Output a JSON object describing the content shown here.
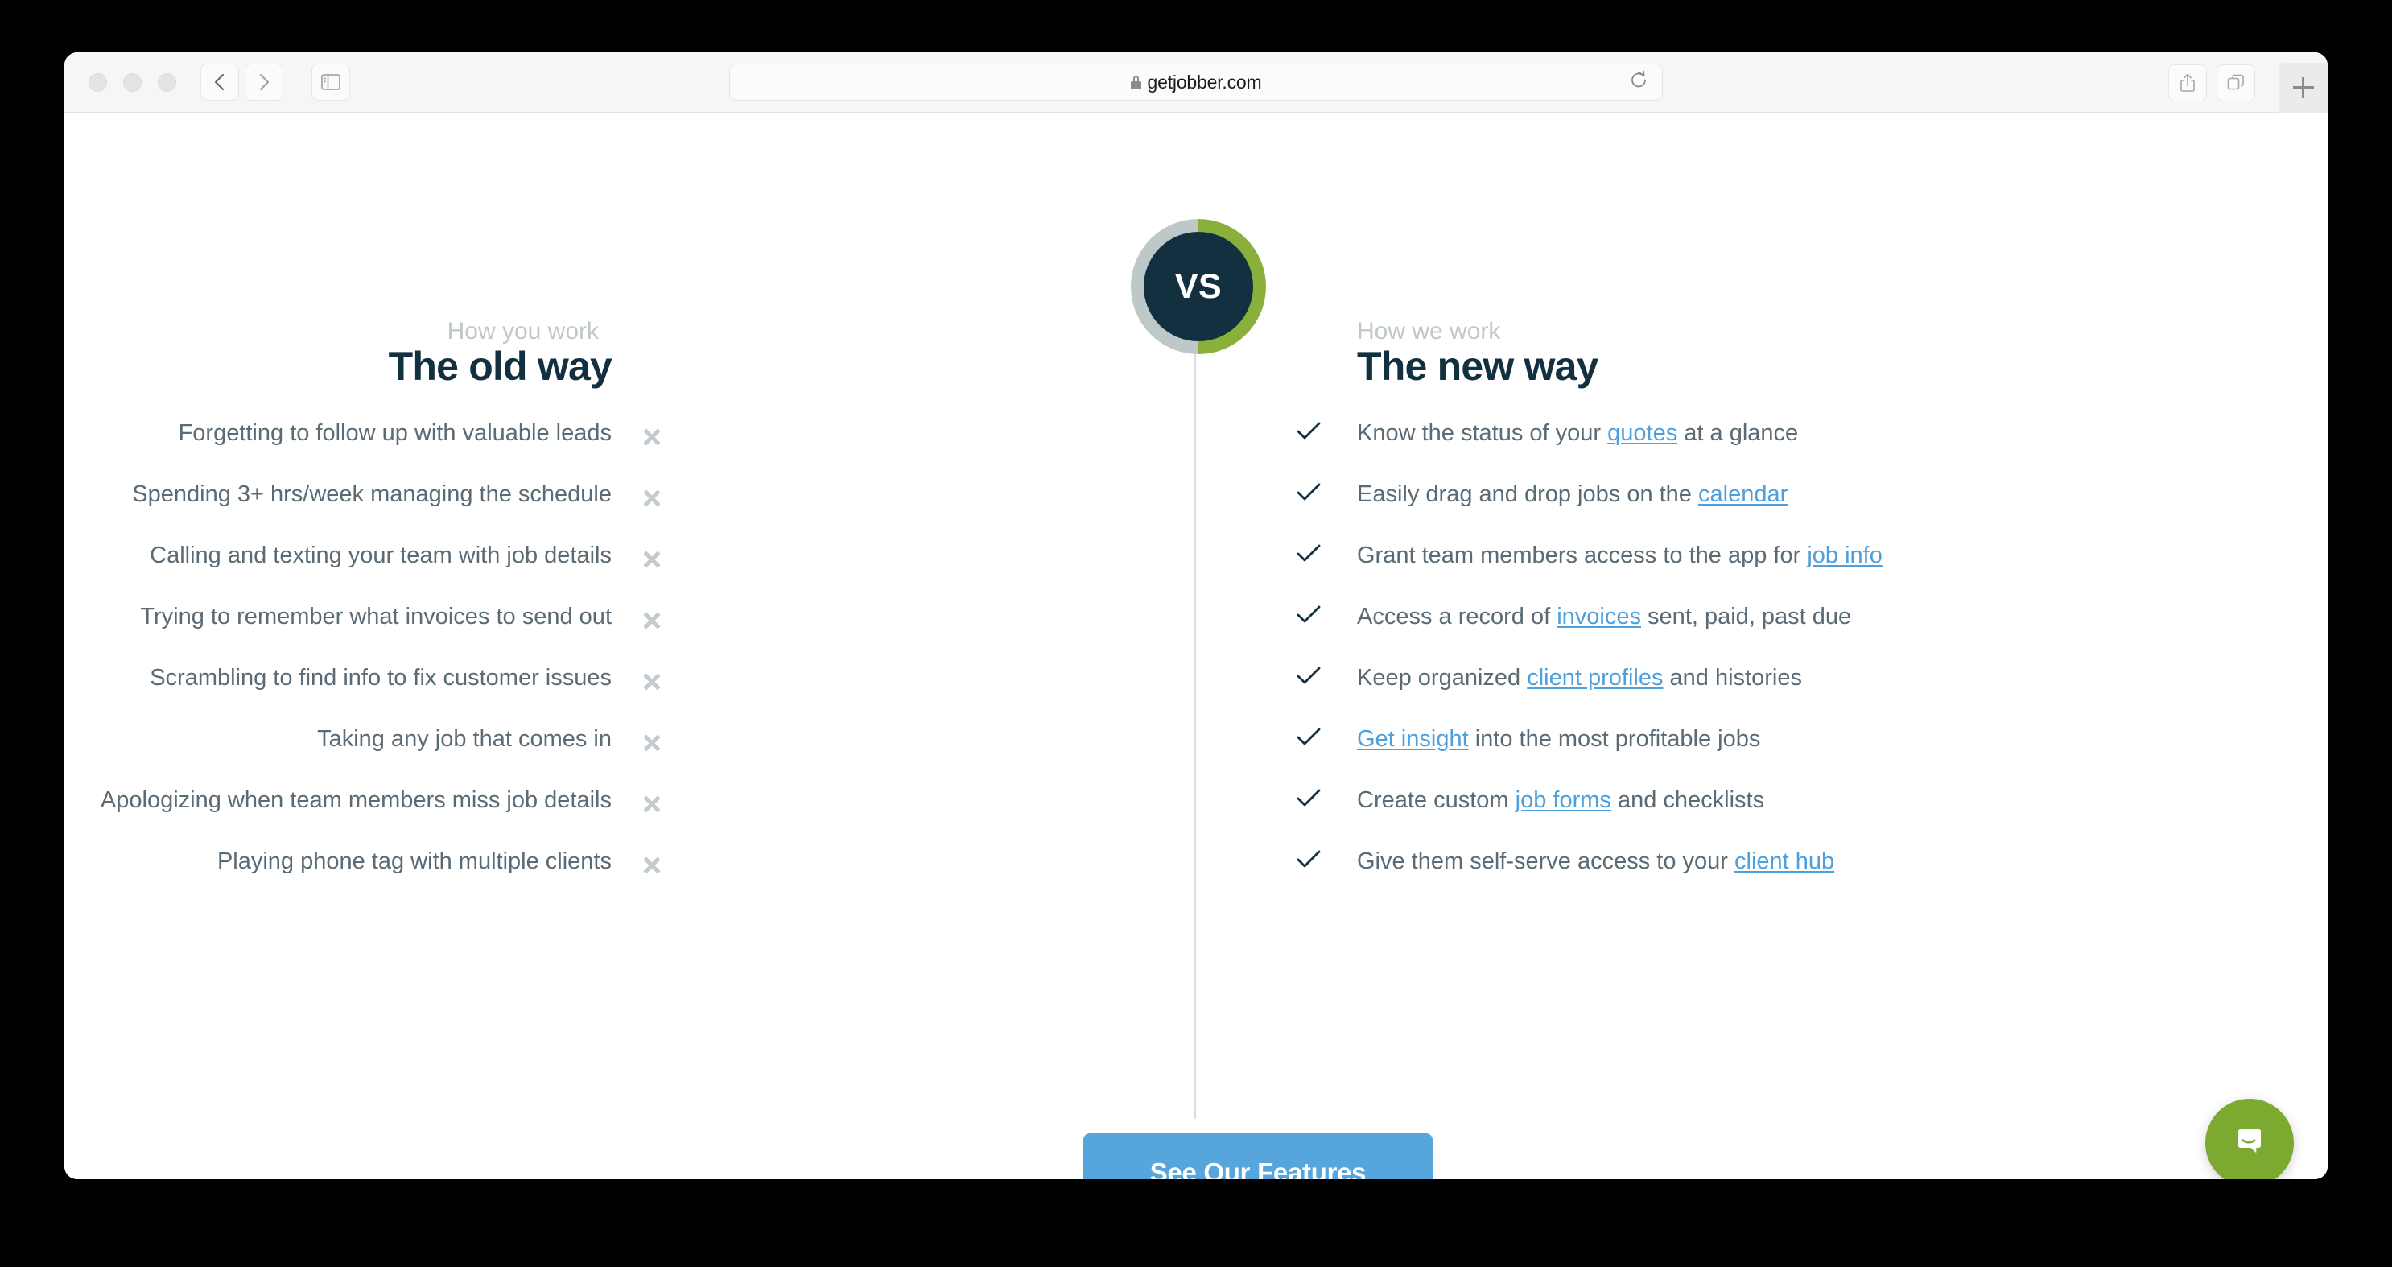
{
  "browser": {
    "url": "getjobber.com",
    "lock_icon": "lock-icon",
    "back_icon": "chevron-left-icon",
    "forward_icon": "chevron-right-icon",
    "sidebar_icon": "sidebar-toggle-icon",
    "reload_icon": "reload-icon",
    "share_icon": "share-icon",
    "tab_overview_icon": "tab-overview-icon",
    "new_tab_icon": "plus-icon"
  },
  "comparison": {
    "badge_label": "VS",
    "left": {
      "eyebrow": "How you work",
      "title": "The old way",
      "mark_icon": "x-icon",
      "items": [
        "Forgetting to follow up with valuable leads",
        "Spending 3+ hrs/week managing the schedule",
        "Calling and texting your team with job details",
        "Trying to remember what invoices to send out",
        "Scrambling to find info to fix customer issues",
        "Taking any job that comes in",
        "Apologizing when team members miss job details",
        "Playing phone tag with multiple clients"
      ]
    },
    "right": {
      "eyebrow": "How we work",
      "title": "The new way",
      "mark_icon": "check-icon",
      "items": [
        {
          "before": "Know the status of your ",
          "link": "quotes",
          "after": " at a glance"
        },
        {
          "before": "Easily drag and drop jobs on the ",
          "link": "calendar",
          "after": ""
        },
        {
          "before": "Grant team members access to the app for ",
          "link": "job info",
          "after": ""
        },
        {
          "before": "Access a record of ",
          "link": "invoices",
          "after": " sent, paid, past due"
        },
        {
          "before": "Keep organized ",
          "link": "client profiles",
          "after": " and histories"
        },
        {
          "before": "",
          "link": "Get insight",
          "after": " into the most profitable jobs"
        },
        {
          "before": "Create custom ",
          "link": "job forms",
          "after": " and checklists"
        },
        {
          "before": "Give them self-serve access to your ",
          "link": "client hub",
          "after": ""
        }
      ]
    }
  },
  "cta": {
    "label": "See Our Features"
  },
  "chat_widget": {
    "icon": "chat-bubble-icon"
  },
  "colors": {
    "navy": "#12303f",
    "green": "#8ab03c",
    "gray_ring": "#bfc8c9",
    "slate_text": "#5a6b75",
    "link_blue": "#4ea0dd",
    "cta_blue": "#57a5dd",
    "x_gray": "#c3cbcf",
    "intercom_green": "#7ca92f"
  }
}
